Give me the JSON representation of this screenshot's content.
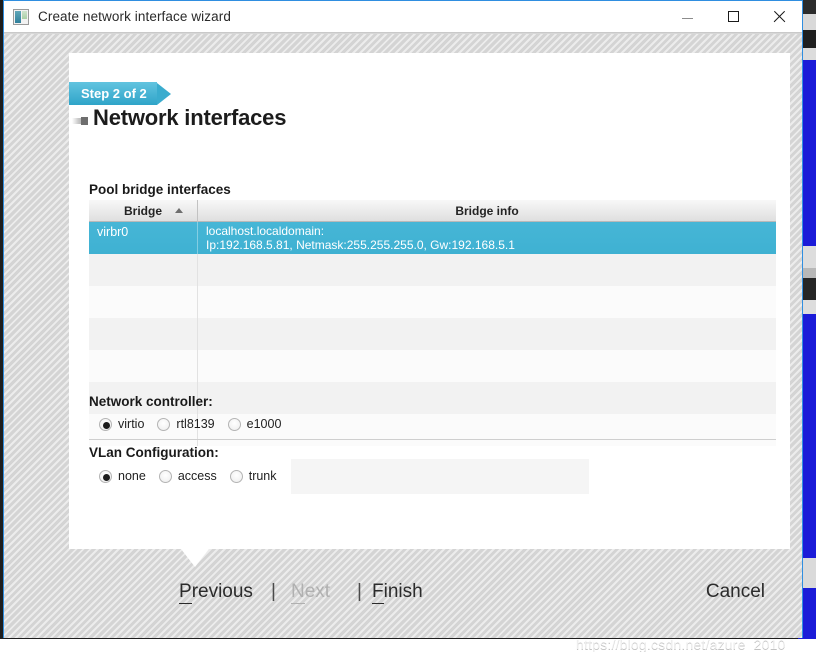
{
  "window": {
    "title": "Create network interface wizard",
    "icon": "app-window-icon",
    "controls": {
      "minimize": "minimize-icon",
      "maximize": "maximize-icon",
      "close": "close-icon"
    }
  },
  "wizard": {
    "step_chip": "Step 2 of 2",
    "page_title": "Network interfaces"
  },
  "table": {
    "caption": "Pool bridge interfaces",
    "columns": [
      {
        "key": "bridge",
        "label": "Bridge",
        "sort": "ascending"
      },
      {
        "key": "info",
        "label": "Bridge info"
      }
    ],
    "rows": [
      {
        "bridge": "virbr0",
        "info_line1": "localhost.localdomain:",
        "info_line2": "Ip:192.168.5.81, Netmask:255.255.255.0, Gw:192.168.5.1",
        "selected": true
      },
      {
        "bridge": "",
        "info_line1": "",
        "info_line2": "",
        "selected": false
      },
      {
        "bridge": "",
        "info_line1": "",
        "info_line2": "",
        "selected": false
      },
      {
        "bridge": "",
        "info_line1": "",
        "info_line2": "",
        "selected": false
      },
      {
        "bridge": "",
        "info_line1": "",
        "info_line2": "",
        "selected": false
      },
      {
        "bridge": "",
        "info_line1": "",
        "info_line2": "",
        "selected": false
      },
      {
        "bridge": "",
        "info_line1": "",
        "info_line2": "",
        "selected": false
      }
    ]
  },
  "network_controller": {
    "label": "Network controller:",
    "options": [
      {
        "label": "virtio",
        "checked": true
      },
      {
        "label": "rtl8139",
        "checked": false
      },
      {
        "label": "e1000",
        "checked": false
      }
    ]
  },
  "vlan_configuration": {
    "label": "VLan Configuration:",
    "options": [
      {
        "label": "none",
        "checked": true
      },
      {
        "label": "access",
        "checked": false
      },
      {
        "label": "trunk",
        "checked": false
      }
    ],
    "field_value": "",
    "field_placeholder": ""
  },
  "footer": {
    "previous": {
      "mnemonic": "P",
      "rest": "revious",
      "enabled": true
    },
    "separator1": "|",
    "next": {
      "mnemonic": "N",
      "rest": "ext",
      "enabled": false
    },
    "separator2": "|",
    "finish": {
      "mnemonic": "F",
      "rest": "inish",
      "enabled": true
    },
    "cancel": "Cancel"
  },
  "watermark": "https://blog.csdn.net/azure_2010",
  "colors": {
    "accent_cyan": "#3fb1d2",
    "title_border_blue": "#2f8ee0",
    "desktop_blue": "#1b1bd8",
    "card_white": "#ffffff",
    "hatch_gray": "#d4d4d4"
  }
}
